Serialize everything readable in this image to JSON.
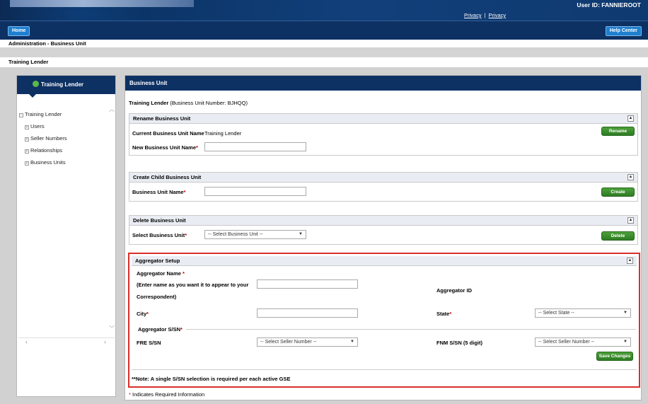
{
  "header": {
    "privacy_1": "Privacy",
    "privacy_sep": "|",
    "privacy_2": "Privacy",
    "user_id": "User ID: FANNIEROOT"
  },
  "nav": {
    "home": "Home",
    "help": "Help Center"
  },
  "breadcrumb": "Administration - Business Unit",
  "page_title": "Training Lender",
  "left_panel": {
    "title": "Training Lender",
    "tree": {
      "root": "Training Lender",
      "children": [
        "Users",
        "Seller Numbers",
        "Relationships",
        "Business Units"
      ]
    }
  },
  "main": {
    "title": "Business Unit",
    "subtitle_name": "Training Lender",
    "subtitle_detail": "(Business Unit Number: BJHQQ)",
    "rename": {
      "header": "Rename Business Unit",
      "current_label": "Current Business Unit Name",
      "current_value": "Training Lender",
      "new_label": "New Business Unit Name",
      "button": "Rename"
    },
    "create": {
      "header": "Create Child Business Unit",
      "name_label": "Business Unit Name",
      "button": "Create"
    },
    "delete": {
      "header": "Delete Business Unit",
      "select_label": "Select Business Unit",
      "select_value": "-- Select Business Unit --",
      "button": "Delete"
    },
    "aggregator": {
      "header": "Aggregator Setup",
      "name_label": "Aggregator Name",
      "name_hint_1": "(Enter name as you want it to appear to your",
      "name_hint_2": "Correspondent)",
      "id_label": "Aggregator ID",
      "city_label": "City",
      "state_label": "State",
      "state_value": "-- Select State --",
      "ssn_group": "Aggregator S/SN",
      "fre_label": "FRE S/SN",
      "fre_value": "-- Select Seller Number --",
      "fnm_label": "FNM S/SN (5 digit)",
      "fnm_value": "-- Select Seller Number --",
      "save_button": "Save Changes",
      "note": "**Note: A single S/SN selection is required per each active GSE"
    },
    "footnote": "Indicates Required Information",
    "required_mark": "*"
  }
}
